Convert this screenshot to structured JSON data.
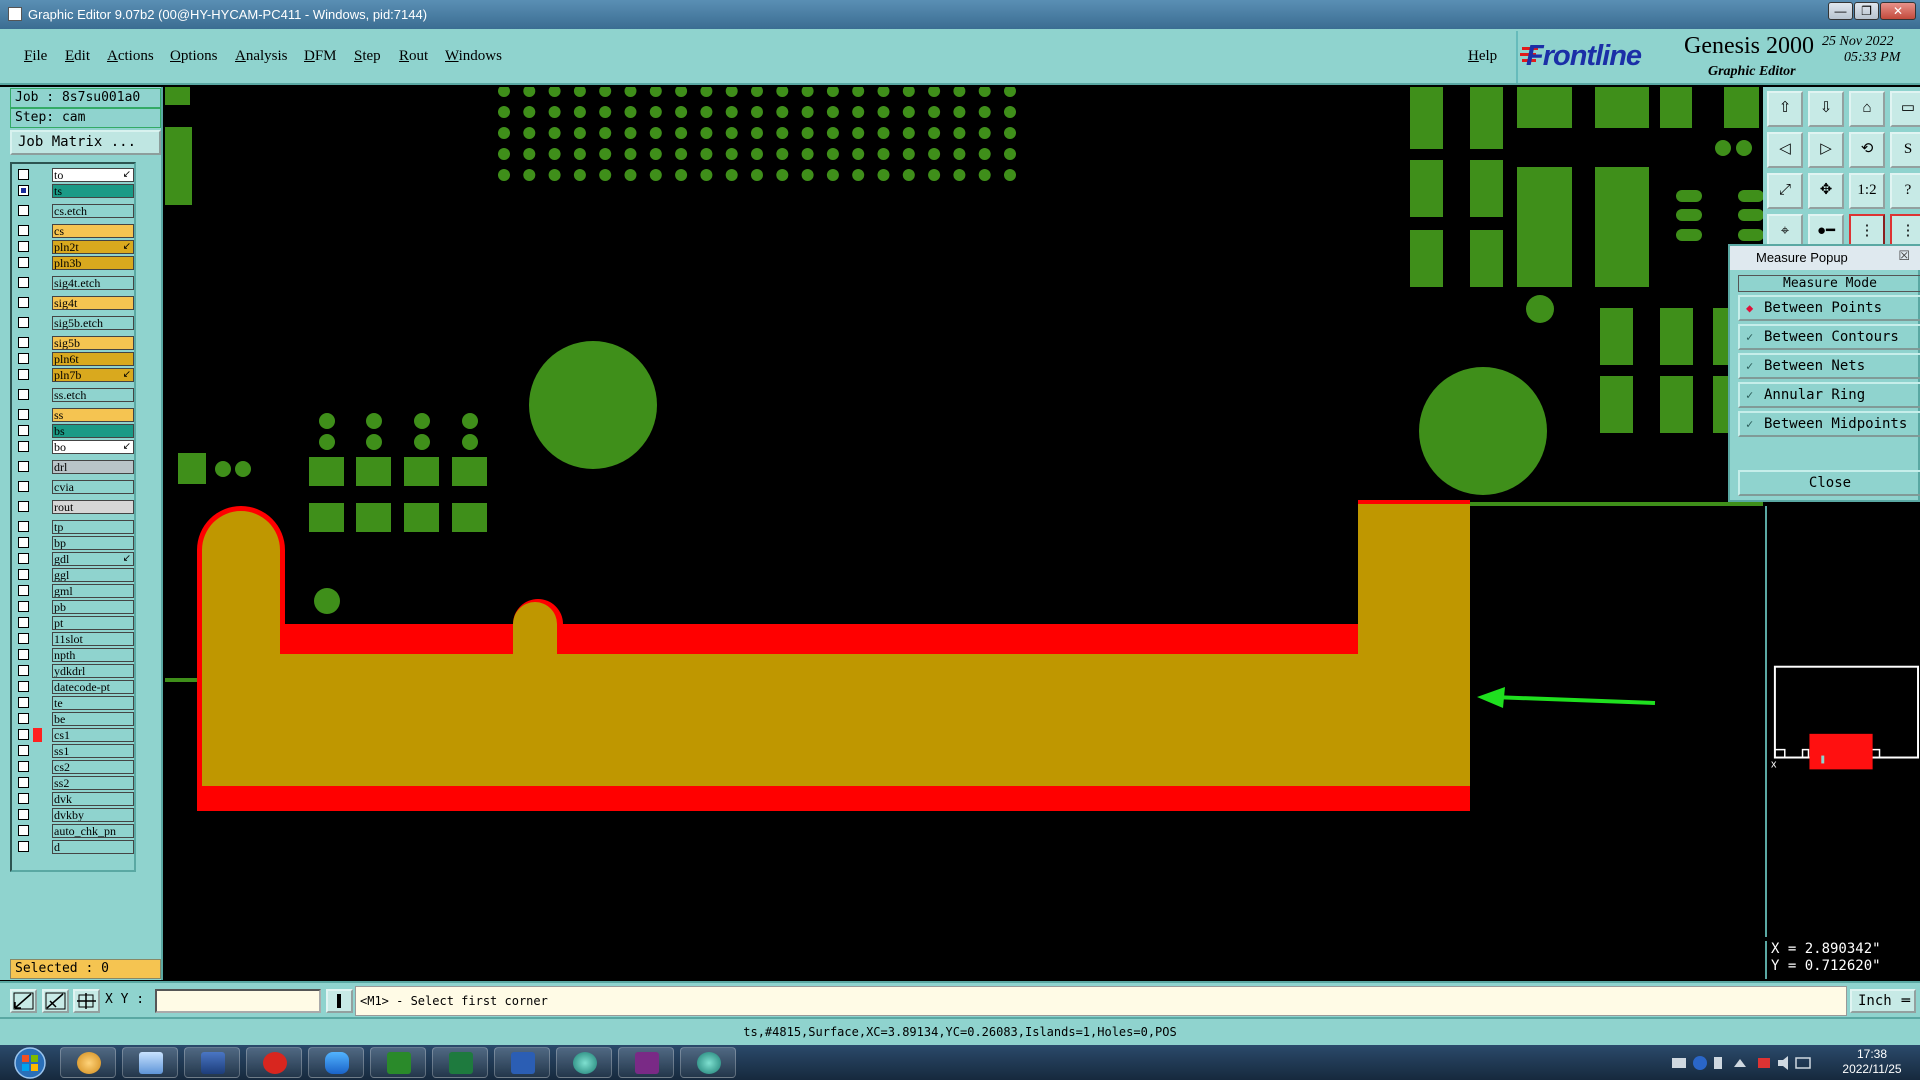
{
  "window": {
    "title": "Graphic Editor 9.07b2 (00@HY-HYCAM-PC411 - Windows, pid:7144)",
    "controls": [
      "—",
      "❐",
      "✕"
    ]
  },
  "menu": {
    "items": [
      "File",
      "Edit",
      "Actions",
      "Options",
      "Analysis",
      "DFM",
      "Step",
      "Rout",
      "Windows"
    ],
    "help": "Help"
  },
  "brand": {
    "logo": "Frontline",
    "product": "Genesis 2000",
    "subtitle": "Graphic Editor",
    "date": "25 Nov 2022",
    "time": "05:33 PM"
  },
  "job": {
    "job_label": "Job : 8s7su001a0",
    "step_label": "Step: cam",
    "matrix_button": "Job Matrix ..."
  },
  "layers": [
    {
      "name": "to",
      "color": "#ffffff",
      "arrow": true
    },
    {
      "name": "ts",
      "color": "#1b9a86",
      "active": true
    },
    {
      "name": "cs.etch",
      "color": "#8fd3ce",
      "gap": true
    },
    {
      "name": "cs",
      "color": "#f5c451",
      "gap": true
    },
    {
      "name": "pln2t",
      "color": "#d9a91e",
      "arrow": true
    },
    {
      "name": "pln3b",
      "color": "#d9a91e"
    },
    {
      "name": "sig4t.etch",
      "color": "#8fd3ce",
      "gap": true
    },
    {
      "name": "sig4t",
      "color": "#f5c451",
      "gap": true
    },
    {
      "name": "sig5b.etch",
      "color": "#8fd3ce",
      "gap": true
    },
    {
      "name": "sig5b",
      "color": "#f5c451",
      "gap": true
    },
    {
      "name": "pln6t",
      "color": "#d9a91e"
    },
    {
      "name": "pln7b",
      "color": "#d9a91e",
      "arrow": true
    },
    {
      "name": "ss.etch",
      "color": "#8fd3ce",
      "gap": true
    },
    {
      "name": "ss",
      "color": "#f5c451",
      "gap": true
    },
    {
      "name": "bs",
      "color": "#1b9a86"
    },
    {
      "name": "bo",
      "color": "#ffffff",
      "arrow": true
    },
    {
      "name": "drl",
      "color": "#b9c4c8",
      "gap": true
    },
    {
      "name": "cvia",
      "color": "#8fd3ce",
      "gap": true
    },
    {
      "name": "rout",
      "color": "#d6d6d6",
      "gap": true
    },
    {
      "name": "tp",
      "color": "#8fd3ce",
      "gap": true
    },
    {
      "name": "bp",
      "color": "#8fd3ce"
    },
    {
      "name": "gdl",
      "color": "#8fd3ce",
      "arrow": true
    },
    {
      "name": "ggl",
      "color": "#8fd3ce"
    },
    {
      "name": "gml",
      "color": "#8fd3ce"
    },
    {
      "name": "pb",
      "color": "#8fd3ce"
    },
    {
      "name": "pt",
      "color": "#8fd3ce"
    },
    {
      "name": "11slot",
      "color": "#8fd3ce"
    },
    {
      "name": "npth",
      "color": "#8fd3ce"
    },
    {
      "name": "ydkdrl",
      "color": "#8fd3ce"
    },
    {
      "name": "datecode-pt",
      "color": "#8fd3ce"
    },
    {
      "name": "te",
      "color": "#8fd3ce"
    },
    {
      "name": "be",
      "color": "#8fd3ce"
    },
    {
      "name": "cs1",
      "color": "#8fd3ce",
      "mark": "#ff2020"
    },
    {
      "name": "ss1",
      "color": "#8fd3ce"
    },
    {
      "name": "cs2",
      "color": "#8fd3ce"
    },
    {
      "name": "ss2",
      "color": "#8fd3ce"
    },
    {
      "name": "dvk",
      "color": "#8fd3ce"
    },
    {
      "name": "dvkby",
      "color": "#8fd3ce"
    },
    {
      "name": "auto_chk_pn",
      "color": "#8fd3ce"
    },
    {
      "name": "d",
      "color": "#8fd3ce"
    }
  ],
  "selected": "Selected : 0",
  "measure": {
    "title": "Measure Popup",
    "close_x": "☒",
    "header": "Measure Mode",
    "options": [
      "Between Points",
      "Between Contours",
      "Between Nets",
      "Annular Ring",
      "Between Midpoints"
    ],
    "selected": "Between Points",
    "close_button": "Close"
  },
  "coords": {
    "x": "X = 2.890342\"",
    "y": "Y = 0.712620\""
  },
  "command": {
    "xy_label": "X Y :",
    "xy_value": "",
    "prompt": "<M1> - Select first corner",
    "units": "Inch"
  },
  "status": "ts,#4815,Surface,XC=3.89134,YC=0.26083,Islands=1,Holes=0,POS",
  "taskbar": {
    "time": "17:38",
    "date": "2022/11/25"
  },
  "colors": {
    "panel": "#8fd3ce",
    "surface": "#bf9700",
    "red": "#ff0000",
    "pad": "#3f8f1a",
    "arrow": "#1fe01f"
  }
}
